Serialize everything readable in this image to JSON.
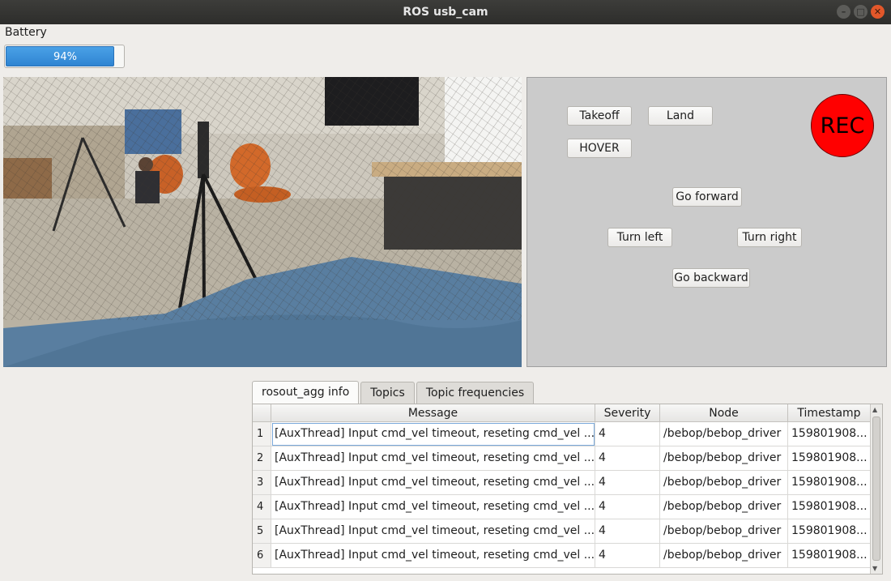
{
  "window": {
    "title": "ROS usb_cam"
  },
  "battery": {
    "label": "Battery",
    "percent": 94,
    "text": "94%"
  },
  "controls": {
    "takeoff": "Takeoff",
    "land": "Land",
    "hover": "HOVER",
    "go_forward": "Go forward",
    "turn_left": "Turn left",
    "turn_right": "Turn right",
    "go_backward": "Go backward",
    "rec": "REC",
    "rec_color": "#ff0000"
  },
  "tabs": [
    "rosout_agg info",
    "Topics",
    "Topic frequencies"
  ],
  "table": {
    "headers": [
      "Message",
      "Severity",
      "Node",
      "Timestamp"
    ],
    "rows": [
      {
        "n": "1",
        "message": "[AuxThread] Input cmd_vel timeout, reseting cmd_vel ...",
        "severity": "4",
        "node": "/bebop/bebop_driver",
        "timestamp": "159801908..."
      },
      {
        "n": "2",
        "message": "[AuxThread] Input cmd_vel timeout, reseting cmd_vel ...",
        "severity": "4",
        "node": "/bebop/bebop_driver",
        "timestamp": "159801908..."
      },
      {
        "n": "3",
        "message": "[AuxThread] Input cmd_vel timeout, reseting cmd_vel ...",
        "severity": "4",
        "node": "/bebop/bebop_driver",
        "timestamp": "159801908..."
      },
      {
        "n": "4",
        "message": "[AuxThread] Input cmd_vel timeout, reseting cmd_vel ...",
        "severity": "4",
        "node": "/bebop/bebop_driver",
        "timestamp": "159801908..."
      },
      {
        "n": "5",
        "message": "[AuxThread] Input cmd_vel timeout, reseting cmd_vel ...",
        "severity": "4",
        "node": "/bebop/bebop_driver",
        "timestamp": "159801908..."
      },
      {
        "n": "6",
        "message": "[AuxThread] Input cmd_vel timeout, reseting cmd_vel ...",
        "severity": "4",
        "node": "/bebop/bebop_driver",
        "timestamp": "159801908..."
      }
    ]
  },
  "colors": {
    "accent": "#2f84d2",
    "panel": "#cbcbcb",
    "titlebar": "#2d2d2b"
  }
}
